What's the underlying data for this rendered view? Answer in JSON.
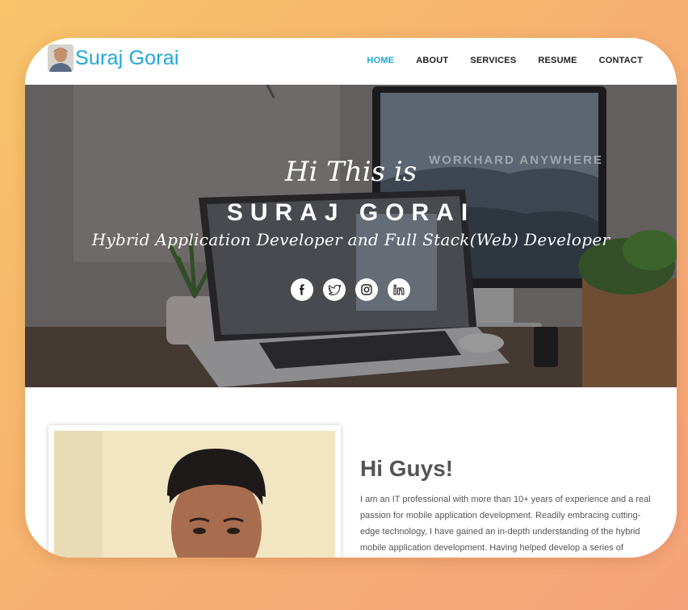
{
  "brand": {
    "name": "Suraj Gorai",
    "avatar_icon": "profile-photo"
  },
  "nav": {
    "items": [
      {
        "label": "HOME",
        "active": true
      },
      {
        "label": "ABOUT",
        "active": false
      },
      {
        "label": "SERVICES",
        "active": false
      },
      {
        "label": "RESUME",
        "active": false
      },
      {
        "label": "CONTACT",
        "active": false
      }
    ]
  },
  "hero": {
    "greeting": "Hi This is",
    "name": "SURAJ GORAI",
    "role": "Hybrid Application Developer and Full Stack(Web) Developer",
    "monitor_text": "WORKHARD ANYWHERE",
    "socials": [
      {
        "icon": "facebook-icon",
        "glyph": "f"
      },
      {
        "icon": "twitter-icon",
        "glyph": "t"
      },
      {
        "icon": "instagram-icon",
        "glyph": "i"
      },
      {
        "icon": "linkedin-icon",
        "glyph": "in"
      }
    ]
  },
  "about": {
    "heading": "Hi Guys!",
    "bio": "I am an IT professional with more than 10+ years of experience and a real passion for mobile application development. Readily embracing cutting-edge technology, I have gained an in-depth understanding of the hybrid mobile application development. Having helped develop a series of commercially"
  },
  "colors": {
    "accent": "#1ea7d8",
    "text": "#555555",
    "bg_start": "#f7c46a",
    "bg_end": "#f6a27a"
  }
}
